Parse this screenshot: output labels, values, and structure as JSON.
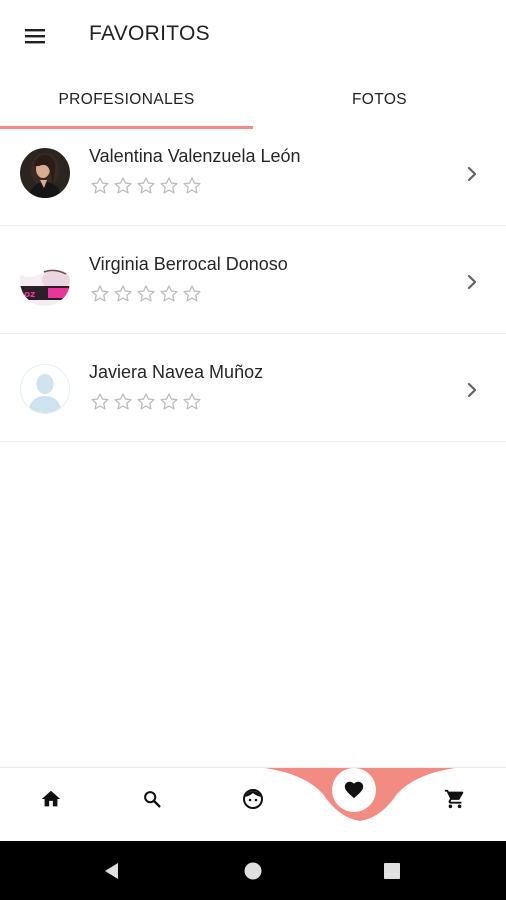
{
  "header": {
    "title": "FAVORITOS",
    "menu_icon": "hamburger-menu-icon"
  },
  "tabs": [
    {
      "label": "PROFESIONALES",
      "selected": true
    },
    {
      "label": "FOTOS",
      "selected": false
    }
  ],
  "professionals": [
    {
      "name": "Valentina Valenzuela León",
      "rating": 0,
      "max_rating": 5
    },
    {
      "name": "Virginia Berrocal Donoso",
      "rating": 0,
      "max_rating": 5
    },
    {
      "name": "Javiera Navea Muñoz",
      "rating": 0,
      "max_rating": 5
    }
  ],
  "bottom_nav": {
    "items": [
      "home-icon",
      "search-icon",
      "face-icon",
      "heart-icon",
      "cart-icon"
    ],
    "active": "heart-icon"
  },
  "colors": {
    "accent": "#f28b82",
    "text": "#212121",
    "star": "#bdbdbd",
    "system_bar": "#000000"
  }
}
